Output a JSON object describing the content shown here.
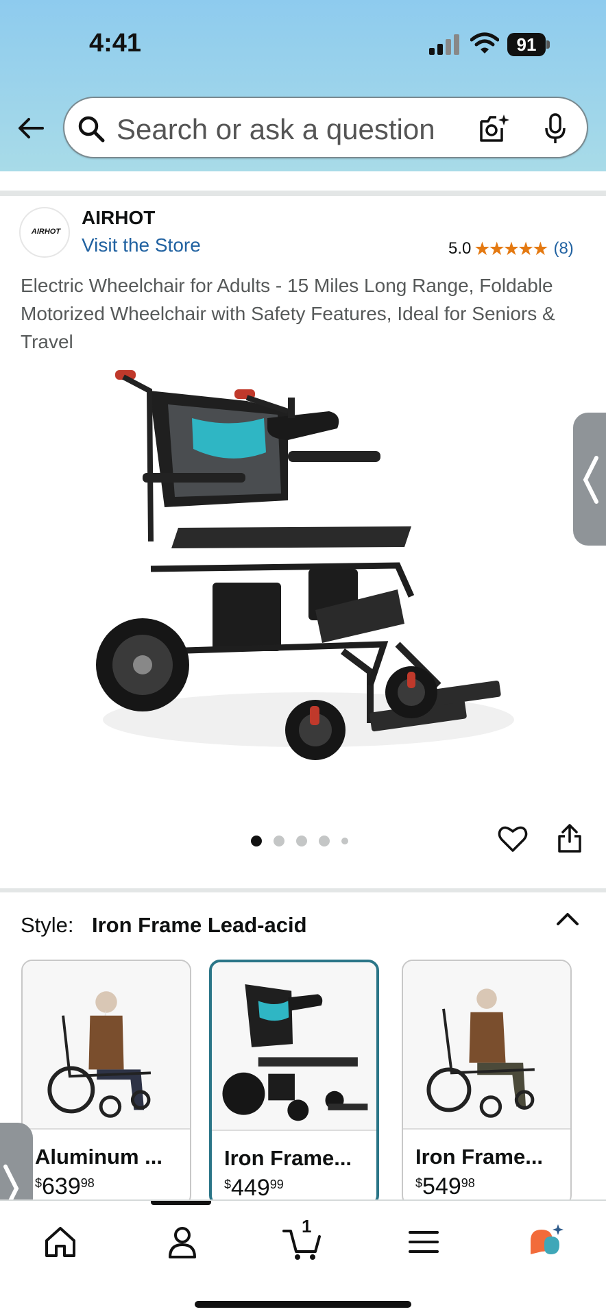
{
  "status_bar": {
    "time": "4:41",
    "battery": "91"
  },
  "search": {
    "placeholder": "Search or ask a question"
  },
  "brand": {
    "logo_text": "AIRHOT",
    "name": "AIRHOT",
    "visit_store": "Visit the Store"
  },
  "rating": {
    "value": "5.0",
    "stars": 5,
    "count": "(8)",
    "star_color": "#e47911"
  },
  "product": {
    "title": "Electric Wheelchair for Adults - 15 Miles Long Range, Foldable Motorized Wheelchair with Safety Features, Ideal for Seniors & Travel",
    "image_count": 5,
    "active_image": 1
  },
  "style_selector": {
    "label": "Style:",
    "selected": "Iron Frame Lead-acid",
    "options": [
      {
        "name": "Aluminum ...",
        "currency": "$",
        "whole": "639",
        "fraction": "98"
      },
      {
        "name": "Iron Frame...",
        "currency": "$",
        "whole": "449",
        "fraction": "99",
        "selected": true
      },
      {
        "name": "Iron Frame...",
        "currency": "$",
        "whole": "549",
        "fraction": "98"
      }
    ]
  },
  "nav": {
    "cart_count": "1"
  },
  "colors": {
    "link": "#2162a1",
    "accent": "#2a7587",
    "header_bg": "#8ecbee"
  }
}
